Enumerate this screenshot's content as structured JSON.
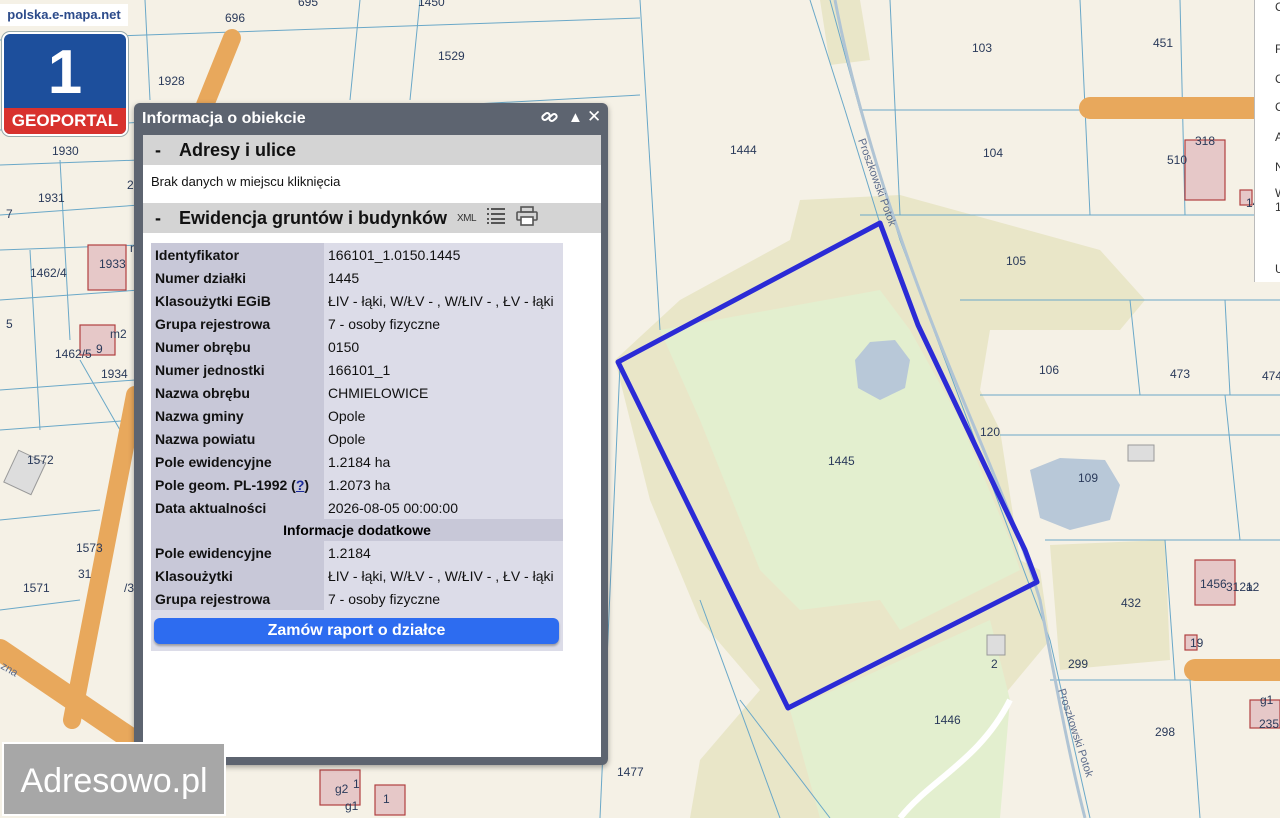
{
  "site": {
    "url": "polska.e-mapa.net",
    "logo_number": "1",
    "logo_text": "GEOPORTAL"
  },
  "watermark": "Adresowo.pl",
  "map": {
    "plot_labels": [
      "696",
      "695",
      "1529",
      "1450",
      "103",
      "451",
      "1928",
      "1930",
      "1931",
      "1933",
      "1462/4",
      "1462/5",
      "1934",
      "1572",
      "1573",
      "1571",
      "1444",
      "104",
      "510",
      "105",
      "106",
      "473",
      "474",
      "1445",
      "120",
      "109",
      "432",
      "2",
      "299",
      "1446",
      "298",
      "235",
      "1477",
      "1456",
      "312a",
      "12",
      "318",
      "9",
      "m2",
      "m2",
      "7",
      "5",
      "/3",
      "31",
      "2",
      "146",
      "19",
      "1",
      "1",
      "g1",
      "g2",
      "g1",
      "g2",
      "5"
    ],
    "street_labels": [
      "Proszkowski Potok",
      "Proszkowski Potok",
      "zna"
    ]
  },
  "panel": {
    "title": "Informacja o obiekcie",
    "section1_title": "Adresy i ulice",
    "section1_message": "Brak danych w miejscu kliknięcia",
    "section2_title": "Ewidencja gruntów i budynków",
    "xml_label": "XML",
    "rows": [
      {
        "key": "Identyfikator",
        "value": "166101_1.0150.1445"
      },
      {
        "key": "Numer działki",
        "value": "1445"
      },
      {
        "key": "Klasoużytki EGiB",
        "value": "ŁIV - łąki, W/ŁV - , W/ŁIV - , ŁV - łąki"
      },
      {
        "key": "Grupa rejestrowa",
        "value": "7 - osoby fizyczne"
      },
      {
        "key": "Numer obrębu",
        "value": "0150"
      },
      {
        "key": "Numer jednostki",
        "value": "166101_1"
      },
      {
        "key": "Nazwa obrębu",
        "value": "CHMIELOWICE"
      },
      {
        "key": "Nazwa gminy",
        "value": "Opole"
      },
      {
        "key": "Nazwa powiatu",
        "value": "Opole"
      },
      {
        "key": "Pole ewidencyjne",
        "value": "1.2184 ha"
      },
      {
        "key": "Pole geom. PL-1992",
        "key_help": "?",
        "value": "1.2073 ha"
      },
      {
        "key": "Data aktualności",
        "value": "2026-08-05 00:00:00"
      }
    ],
    "extra_title": "Informacje dodatkowe",
    "extra_rows": [
      {
        "key": "Pole ewidencyjne",
        "value": "1.2184"
      },
      {
        "key": "Klasoużytki",
        "value": "ŁIV - łąki, W/ŁV - , W/ŁIV - , ŁV - łąki"
      },
      {
        "key": "Grupa rejestrowa",
        "value": "7 - osoby fizyczne"
      }
    ],
    "report_button": "Zamów raport o działce"
  },
  "side_fragment": {
    "letters": [
      "C",
      "F",
      "C",
      "C",
      "A",
      "N",
      "W",
      "1",
      "Uk"
    ]
  },
  "colors": {
    "parcel_outline": "#2b2bd6",
    "road": "#e8a85c",
    "water": "#b8c8d8",
    "meadow": "#e3efcf",
    "panel_frame": "#5d6470",
    "report_button": "#2d6cf0"
  }
}
